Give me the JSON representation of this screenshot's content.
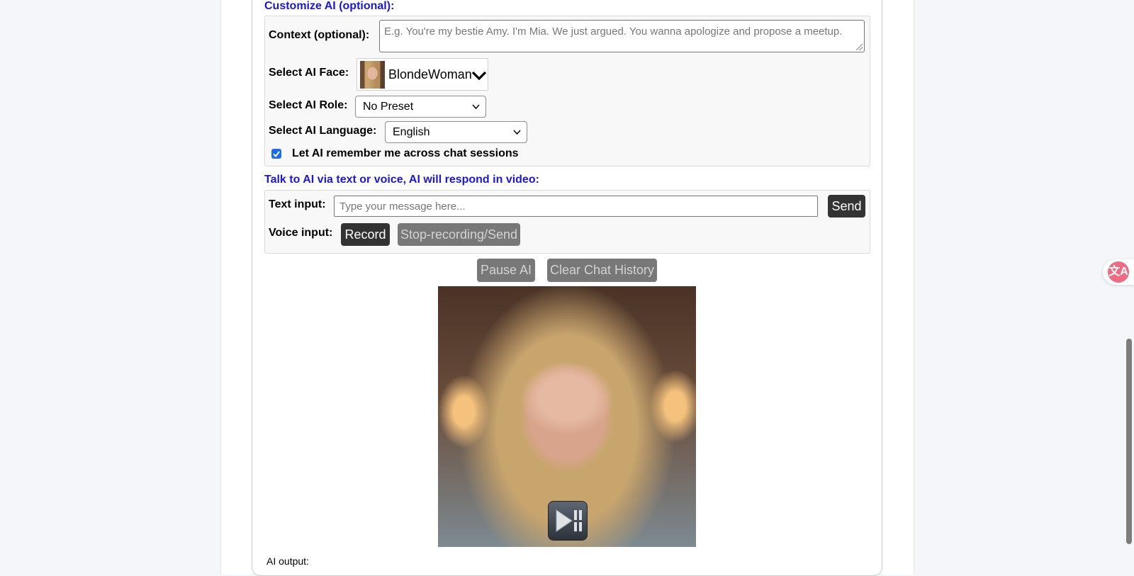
{
  "customize": {
    "title": "Customize AI (optional):",
    "context_label": "Context (optional):",
    "context_placeholder": "E.g. You're my bestie Amy. I'm Mia. We just argued. You wanna apologize and propose a meetup.",
    "face_label": "Select AI Face:",
    "face_value": "BlondeWoman",
    "role_label": "Select AI Role:",
    "role_value": "No Preset",
    "language_label": "Select AI Language:",
    "language_value": "English",
    "remember_label": "Let AI remember me across chat sessions",
    "remember_checked": true
  },
  "talk": {
    "title": "Talk to AI via text or voice, AI will respond in video:",
    "text_label": "Text input:",
    "text_placeholder": "Type your message here...",
    "send_label": "Send",
    "voice_label": "Voice input:",
    "record_label": "Record",
    "stop_label": "Stop-recording/Send"
  },
  "controls": {
    "pause_label": "Pause AI",
    "clear_label": "Clear Chat History"
  },
  "output": {
    "label": "AI output:"
  },
  "icons": {
    "face_thumb": "portrait-thumbnail",
    "face_dropdown": "chevron-down-icon",
    "play": "play-pause-icon",
    "translate": "translate-icon"
  },
  "colors": {
    "accent_title": "#1a17d8",
    "button_dark": "#333333",
    "button_disabled": "#787878",
    "checkbox": "#1a6fe8",
    "translate": "#ec6d83"
  }
}
